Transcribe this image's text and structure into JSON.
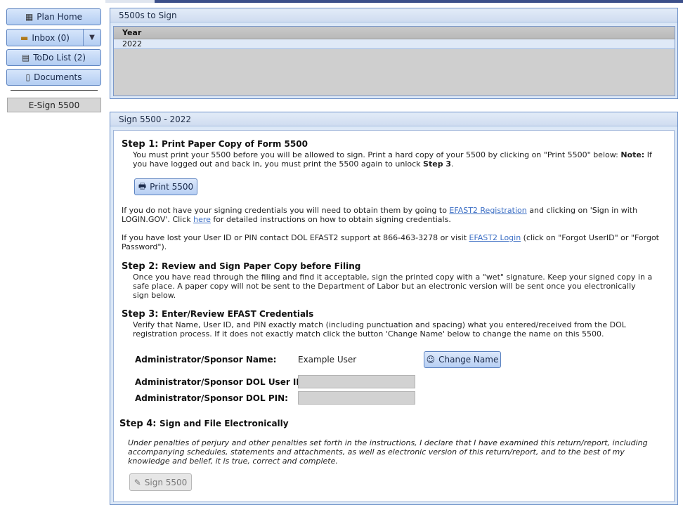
{
  "sidebar": {
    "plan_home": "Plan Home",
    "inbox": "Inbox (0)",
    "todo": "ToDo List (2)",
    "documents": "Documents",
    "esign": "E-Sign 5500"
  },
  "panel1": {
    "title": "5500s to Sign",
    "column_year": "Year",
    "rows": [
      "2022"
    ]
  },
  "panel2": {
    "title": "Sign 5500 - 2022",
    "step1": {
      "label": "Step 1:",
      "title": "Print Paper Copy of Form 5500",
      "text1": "You must print your 5500 before you will be allowed to sign. Print a hard copy of your 5500 by clicking on \"Print 5500\" below: ",
      "note": "Note:",
      "text2": "If you have logged out and back in, you must print the 5500 again to unlock ",
      "step3_ref": "Step 3",
      "text3": ".",
      "print_button": "Print 5500"
    },
    "credentials": {
      "p1_a": "If you do not have your signing credentials you will need to obtain them by going to ",
      "p1_link": "EFAST2 Registration",
      "p1_b": " and clicking on 'Sign in with LOGIN.GOV'. Click ",
      "p1_here": "here",
      "p1_c": " for detailed instructions on how to obtain signing credentials.",
      "p2_a": "If you have lost your User ID or PIN contact DOL EFAST2 support at 866-463-3278 or visit ",
      "p2_link": "EFAST2 Login",
      "p2_b": " (click on \"Forgot UserID\" or \"Forgot Password\")."
    },
    "step2": {
      "label": "Step 2:",
      "title": "Review and Sign Paper Copy before Filing",
      "text": "Once you have read through the filing and find it acceptable, sign the printed copy with a \"wet\" signature. Keep your signed copy in a safe place. A paper copy will not be sent to the Department of Labor but an electronic version will be sent once you electronically sign below."
    },
    "step3": {
      "label": "Step 3:",
      "title": "Enter/Review EFAST Credentials",
      "text": "Verify that Name, User ID, and PIN exactly match (including punctuation and spacing) what you entered/received from the DOL registration process. If it does not exactly match click the button 'Change Name' below to change the name on this 5500.",
      "name_label": "Administrator/Sponsor Name:",
      "name_value": "Example User",
      "change_name_button": "Change Name",
      "userid_label": "Administrator/Sponsor DOL User ID:",
      "userid_value": "",
      "pin_label": "Administrator/Sponsor DOL PIN:",
      "pin_value": ""
    },
    "step4": {
      "label": "Step 4:",
      "title": "Sign and File Electronically",
      "text": "Under penalties of perjury and other penalties set forth in the instructions, I declare that I have examined this return/report, including accompanying schedules, statements and attachments, as well as electronic version of this return/report, and to the best of my knowledge and belief, it is true, correct and complete.",
      "sign_button": "Sign 5500"
    }
  },
  "colors": {
    "accent": "#3b4f8a",
    "button_gradient_top": "#d7e6fb",
    "button_gradient_bottom": "#b3cdf2",
    "link": "#3b6ec4"
  }
}
